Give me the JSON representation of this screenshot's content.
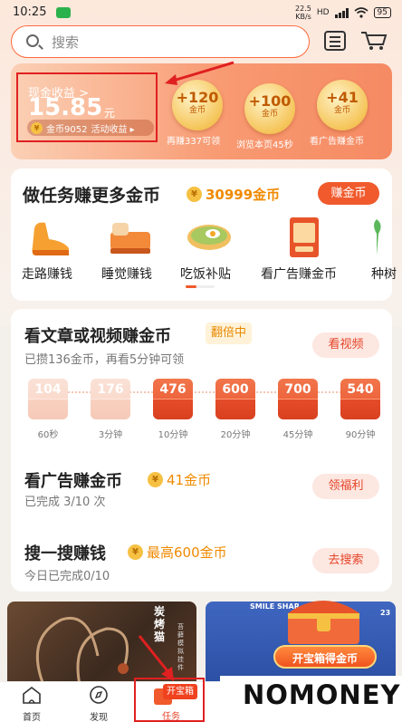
{
  "status_bar": {
    "time": "10:25",
    "net_speed": "22.5",
    "net_unit": "KB/s",
    "battery": "95",
    "signal_label": "HD"
  },
  "search": {
    "placeholder": "搜索"
  },
  "earnings": {
    "label": "现金收益 >",
    "amount": "15.85",
    "unit": "元",
    "coins": "金币9052",
    "activity": "活动收益 ▸"
  },
  "bubbles": [
    {
      "value": "+120",
      "unit": "金币",
      "caption": "再赚337可领"
    },
    {
      "value": "+100",
      "unit": "金币",
      "caption": "浏览本页45秒"
    },
    {
      "value": "+41",
      "unit": "金币",
      "caption": "看广告赚金币"
    }
  ],
  "tasks": {
    "title": "做任务赚更多金币",
    "coins": "30999金币",
    "button": "赚金币",
    "items": [
      "走路赚钱",
      "睡觉赚钱",
      "吃饭补贴",
      "看广告赚金币",
      "种树"
    ]
  },
  "article": {
    "title": "看文章或视频赚金币",
    "badge": "翻倍中",
    "subtitle": "已攒136金币，再看5分钟可领",
    "button": "看视频",
    "timeline": [
      {
        "value": "104",
        "label": "60秒",
        "done": true
      },
      {
        "value": "176",
        "label": "3分钟",
        "done": true
      },
      {
        "value": "476",
        "label": "10分钟",
        "done": false
      },
      {
        "value": "600",
        "label": "20分钟",
        "done": false
      },
      {
        "value": "700",
        "label": "45分钟",
        "done": false
      },
      {
        "value": "540",
        "label": "90分钟",
        "done": false
      }
    ]
  },
  "ad_row": {
    "title": "看广告赚金币",
    "coins": "41金币",
    "subtitle": "已完成 3/10 次",
    "button": "领福利"
  },
  "search_row": {
    "title": "搜一搜赚钱",
    "coins": "最高600金币",
    "subtitle": "今日已完成0/10",
    "button": "去搜索"
  },
  "promos": {
    "left_title": "炭烤猫",
    "left_small": "苔藓模拟挂件",
    "right_brand": "SMILE SHAR",
    "right_num": "23",
    "chest_button": "开宝箱得金币"
  },
  "tabbar": {
    "home": "首页",
    "discover": "发现",
    "task": "任务",
    "chest": "开宝箱"
  },
  "watermark": "NOMONEY",
  "colors": {
    "accent": "#f05a2c",
    "coin": "#f08a00",
    "highlight_box": "#e02020"
  }
}
